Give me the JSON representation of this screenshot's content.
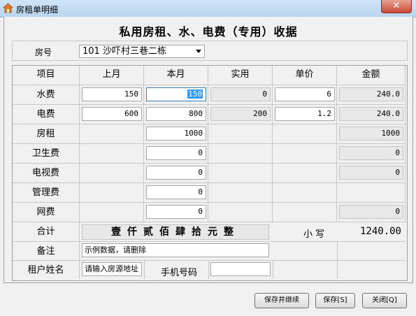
{
  "window": {
    "title": "房租单明细",
    "close_label": "✕"
  },
  "heading": "私用房租、水、电费（专用）收据",
  "room": {
    "label": "房号",
    "selected": "101 沙吓村三巷二栋"
  },
  "columns": [
    "项目",
    "上月",
    "本月",
    "实用",
    "单价",
    "金额"
  ],
  "rows": {
    "water": {
      "label": "水费",
      "last": "150",
      "current": "150",
      "used": "0",
      "price": "6",
      "amount": "240.0"
    },
    "power": {
      "label": "电费",
      "last": "600",
      "current": "800",
      "used": "200",
      "price": "1.2",
      "amount": "240.0"
    },
    "rent": {
      "label": "房租",
      "current": "1000",
      "amount": "1000"
    },
    "hygiene": {
      "label": "卫生费",
      "current": "0",
      "amount": "0"
    },
    "tv": {
      "label": "电视费",
      "current": "0",
      "amount": "0"
    },
    "mgmt": {
      "label": "管理费",
      "current": "0"
    },
    "net": {
      "label": "网费",
      "current": "0",
      "amount": "0"
    }
  },
  "total": {
    "label": "合计",
    "uppercase": "壹仟贰佰肆拾元整",
    "lower_label": "小写",
    "lower_value": "1240.00"
  },
  "remark": {
    "label": "备注",
    "value": "示例数据，请删除"
  },
  "tenant": {
    "label": "租户姓名",
    "value": "请输入房源地址",
    "phone_label": "手机号码",
    "phone_value": ""
  },
  "buttons": {
    "save_continue": "保存并继续",
    "save": "保存[S]",
    "close": "关闭[Q]"
  }
}
